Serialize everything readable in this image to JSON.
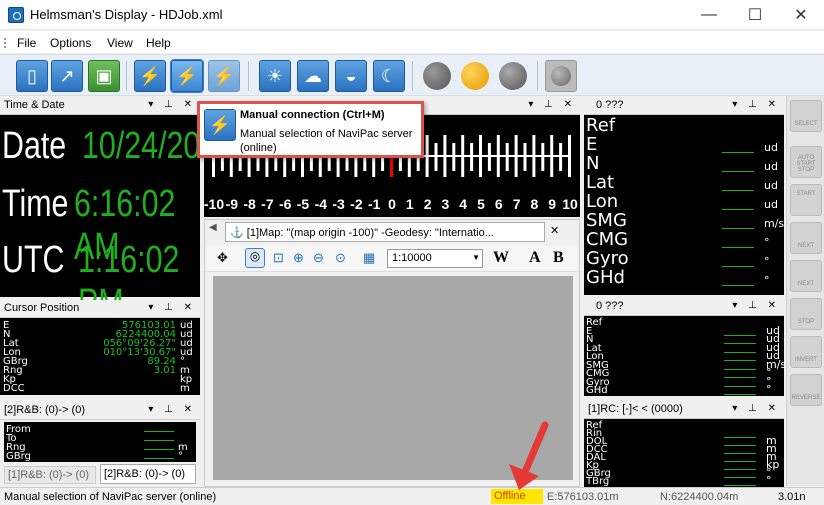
{
  "window": {
    "title": "Helmsman's Display - HDJob.xml",
    "minimize": "—",
    "maximize": "☐",
    "close": "✕"
  },
  "menu": [
    "File",
    "Options",
    "View",
    "Help"
  ],
  "time_panel": {
    "title": "Time & Date",
    "date_label": "Date",
    "date_value": "10/24/2019",
    "time_label": "Time",
    "time_value": "6:16:02 AM",
    "utc_label": "UTC",
    "utc_value": "1:16:02 PM"
  },
  "cursor_panel": {
    "title": "Cursor Position",
    "rows": [
      {
        "label": "E",
        "value": "576103.01",
        "unit": "ud"
      },
      {
        "label": "N",
        "value": "6224400.04",
        "unit": "ud"
      },
      {
        "label": "Lat",
        "value": "056°09'26.27\"",
        "unit": "ud"
      },
      {
        "label": "Lon",
        "value": "010°13'30.67\"",
        "unit": "ud"
      },
      {
        "label": "GBrg",
        "value": "89.24",
        "unit": "°"
      },
      {
        "label": "Rng",
        "value": "3.01",
        "unit": "m"
      },
      {
        "label": "Kp",
        "value": "",
        "unit": "kp"
      },
      {
        "label": "DCC",
        "value": "",
        "unit": "m"
      }
    ]
  },
  "rb_panel": {
    "title": "[2]R&B: (0)-> (0)",
    "rows": [
      {
        "label": "From",
        "unit": ""
      },
      {
        "label": "To",
        "unit": ""
      },
      {
        "label": "Rng",
        "unit": "m"
      },
      {
        "label": "GBrg",
        "unit": "°"
      }
    ],
    "tabs": [
      "[1]R&B: (0)-> (0)",
      "[2]R&B: (0)-> (0)"
    ]
  },
  "ruler": {
    "ticks": [
      "-10",
      "-9",
      "-8",
      "-7",
      "-6",
      "-5",
      "-4",
      "-3",
      "-2",
      "-1",
      "0",
      "1",
      "2",
      "3",
      "4",
      "5",
      "6",
      "7",
      "8",
      "9",
      "10"
    ]
  },
  "map": {
    "tab_title": "[1]Map: \"(map origin -100)\" -Geodesy: \"Internatio...",
    "scale": "1:10000",
    "btn_w": "W",
    "btn_a": "A",
    "btn_b": "B"
  },
  "right_panel_1": {
    "title": "0 ???",
    "rows": [
      {
        "label": "Ref",
        "unit": ""
      },
      {
        "label": "E",
        "unit": "ud"
      },
      {
        "label": "N",
        "unit": "ud"
      },
      {
        "label": "Lat",
        "unit": "ud"
      },
      {
        "label": "Lon",
        "unit": "ud"
      },
      {
        "label": "SMG",
        "unit": "m/s"
      },
      {
        "label": "CMG",
        "unit": "°"
      },
      {
        "label": "Gyro",
        "unit": "°"
      },
      {
        "label": "GHd",
        "unit": "°"
      }
    ]
  },
  "right_panel_2": {
    "title": "0 ???",
    "rows": [
      {
        "label": "Ref",
        "unit": ""
      },
      {
        "label": "E",
        "unit": "ud"
      },
      {
        "label": "N",
        "unit": "ud"
      },
      {
        "label": "Lat",
        "unit": "ud"
      },
      {
        "label": "Lon",
        "unit": "ud"
      },
      {
        "label": "SMG",
        "unit": "m/s"
      },
      {
        "label": "CMG",
        "unit": "°"
      },
      {
        "label": "Gyro",
        "unit": "°"
      },
      {
        "label": "GHd",
        "unit": "°"
      }
    ]
  },
  "right_panel_3": {
    "title": "[1]RC: [-]< < (0000)",
    "rows": [
      {
        "label": "Ref",
        "unit": ""
      },
      {
        "label": "Rin",
        "unit": ""
      },
      {
        "label": "DOL",
        "unit": "m"
      },
      {
        "label": "DCC",
        "unit": "m"
      },
      {
        "label": "DAL",
        "unit": "m"
      },
      {
        "label": "Kp",
        "unit": "kp"
      },
      {
        "label": "GBrg",
        "unit": "°"
      },
      {
        "label": "TBrg",
        "unit": "°"
      }
    ]
  },
  "side_buttons": [
    "SELECT",
    "AUTO START STOP",
    "START",
    "NEXT",
    "NEXT",
    "STOP",
    "INVERT",
    "REVERSE"
  ],
  "tooltip": {
    "title": "Manual connection (Ctrl+M)",
    "body": "Manual selection of NaviPac server (online)"
  },
  "status": {
    "message": "Manual selection of NaviPac server (online)",
    "state": "Offline",
    "east": "E:576103.01m",
    "north": "N:6224400.04m",
    "range": "3.01n"
  }
}
